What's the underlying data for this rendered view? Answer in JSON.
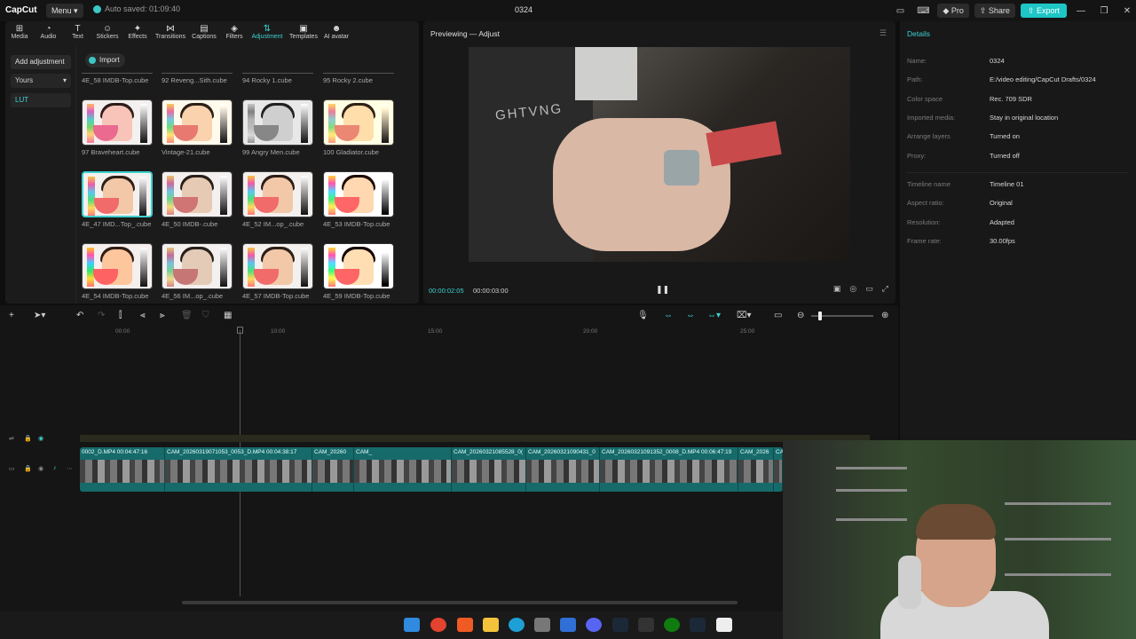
{
  "titlebar": {
    "app_name": "CapCut",
    "menu_label": "Menu",
    "autosave": "Auto saved: 01:09:40",
    "project_title": "0324",
    "pro_label": "Pro",
    "share_label": "Share",
    "export_label": "Export"
  },
  "toolbar": {
    "items": [
      "Media",
      "Audio",
      "Text",
      "Stickers",
      "Effects",
      "Transitions",
      "Captions",
      "Filters",
      "Adjustment",
      "Templates",
      "AI avatar"
    ],
    "active": "Adjustment"
  },
  "sidebar": {
    "add_adjustment": "Add adjustment",
    "dropdown_value": "Yours",
    "lut_label": "LUT"
  },
  "library": {
    "import_label": "Import",
    "top_row": [
      "4E_58 IMDB-Top.cube",
      "92 Reveng...Sith.cube",
      "94 Rocky 1.cube",
      "95 Rocky 2.cube"
    ],
    "items": [
      "97 Braveheart.cube",
      "Vintage-21.cube",
      "99 Angry Men.cube",
      "100 Gladiator.cube",
      "4E_47 IMD...Top_.cube",
      "4E_50 IMDB-.cube",
      "4E_52 IM...op_.cube",
      "4E_53 IMDB-Top.cube",
      "4E_54 IMDB-Top.cube",
      "4E_56 IM...op_.cube",
      "4E_57 IMDB-Top.cube",
      "4E_59 IMDB-Top.cube"
    ]
  },
  "preview": {
    "title": "Previewing — Adjust",
    "current_time": "00:00:02:05",
    "total_time": "00:00:03:00"
  },
  "details": {
    "title": "Details",
    "rows1": [
      {
        "label": "Name:",
        "value": "0324"
      },
      {
        "label": "Path:",
        "value": "E:/video editing/CapCut Drafts/0324"
      },
      {
        "label": "Color space",
        "value": "Rec. 709 SDR"
      },
      {
        "label": "Imported media:",
        "value": "Stay in original location"
      },
      {
        "label": "Arrange layers",
        "value": "Turned on"
      },
      {
        "label": "Proxy:",
        "value": "Turned off"
      }
    ],
    "rows2": [
      {
        "label": "Timeline name",
        "value": "Timeline 01"
      },
      {
        "label": "Aspect ratio:",
        "value": "Original"
      },
      {
        "label": "Resolution:",
        "value": "Adapted"
      },
      {
        "label": "Frame rate:",
        "value": "30.00fps"
      }
    ]
  },
  "timeline": {
    "ruler": [
      "00:00",
      "10:00",
      "15:00",
      "20:00",
      "25:00"
    ],
    "clips": [
      {
        "label": "0002_D.MP4   00:04:47:16"
      },
      {
        "label": "CAM_20260319071053_0053_D.MP4   00:04:38:17"
      },
      {
        "label": "CAM_20260"
      },
      {
        "label": "CAM_"
      },
      {
        "label": "CAM_20260321085528_0("
      },
      {
        "label": "CAM_20260321090431_0"
      },
      {
        "label": "CAM_20260321091352_0008_D.MP4   00:06:47:19"
      },
      {
        "label": "CAM_2026"
      },
      {
        "label": "CA"
      }
    ]
  },
  "colors": {
    "accent": "#3fd0d0",
    "export": "#1ec6c6",
    "clip": "#166a6a"
  }
}
